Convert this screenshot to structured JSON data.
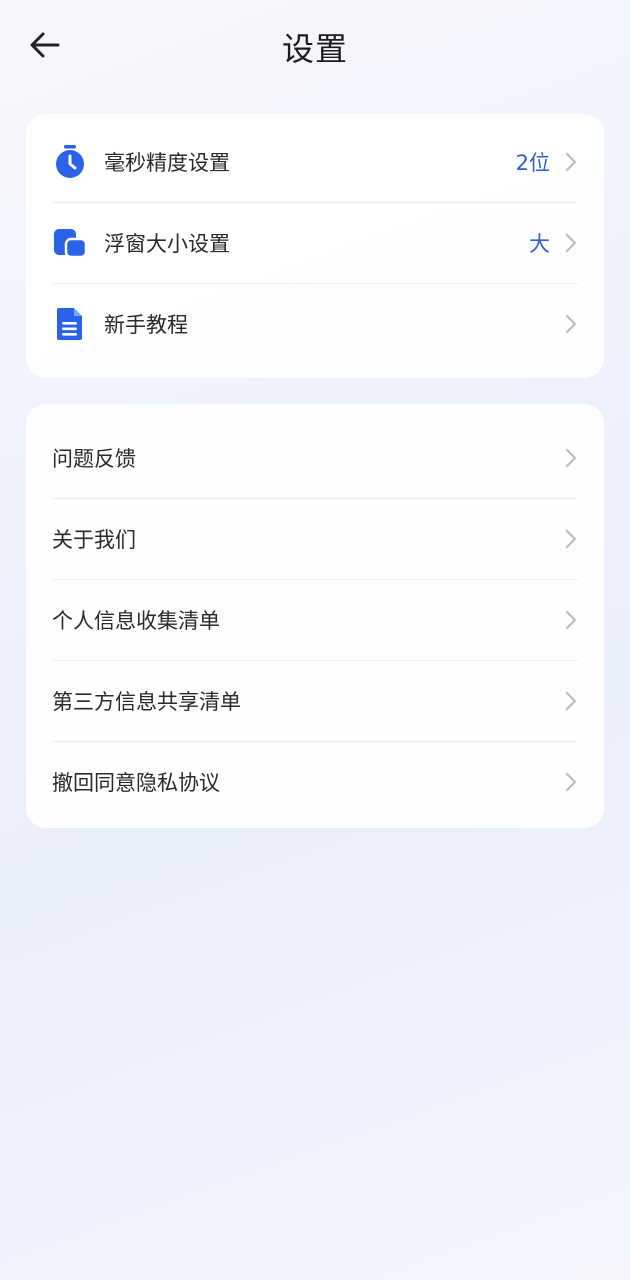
{
  "header": {
    "title": "设置",
    "back_icon": "arrow-left-icon"
  },
  "colors": {
    "accent": "#2c5fd6",
    "icon_blue": "#2a63e8",
    "chevron": "#b8bcc4"
  },
  "settings_card": {
    "items": [
      {
        "label": "毫秒精度设置",
        "value": "2位",
        "icon": "stopwatch-icon"
      },
      {
        "label": "浮窗大小设置",
        "value": "大",
        "icon": "floating-window-icon"
      },
      {
        "label": "新手教程",
        "value": "",
        "icon": "document-icon"
      }
    ]
  },
  "info_card": {
    "items": [
      {
        "label": "问题反馈"
      },
      {
        "label": "关于我们"
      },
      {
        "label": "个人信息收集清单"
      },
      {
        "label": "第三方信息共享清单"
      },
      {
        "label": "撤回同意隐私协议"
      }
    ]
  }
}
